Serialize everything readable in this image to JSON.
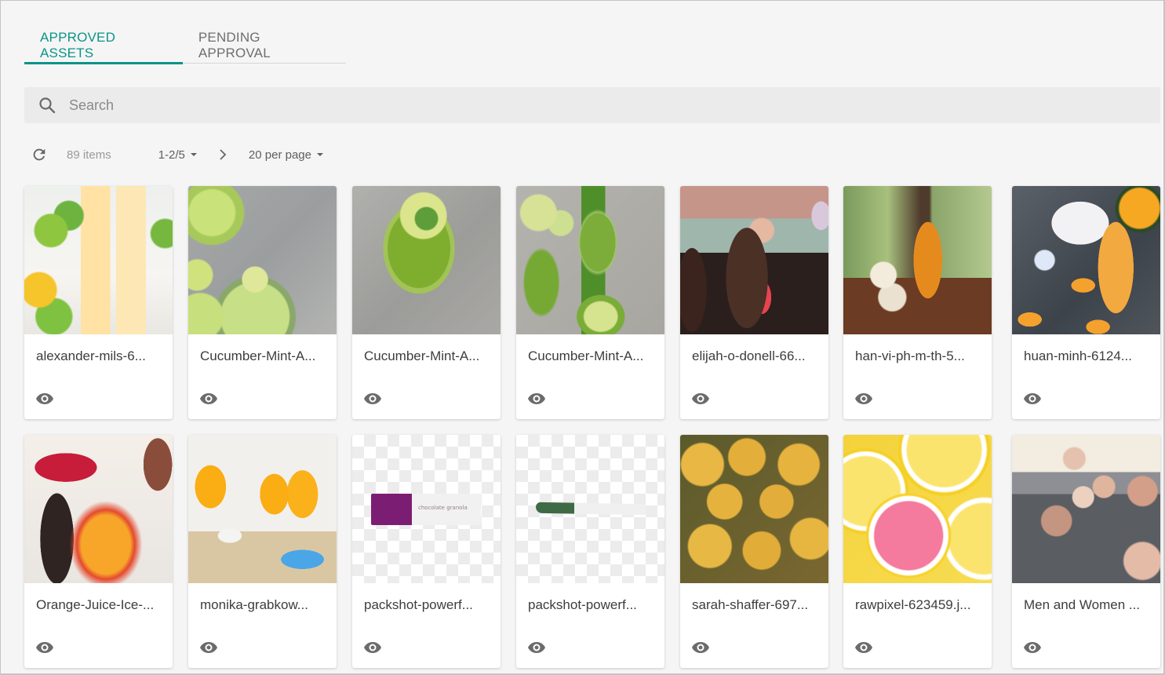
{
  "tabs": [
    {
      "label": "APPROVED ASSETS",
      "active": true
    },
    {
      "label": "PENDING APPROVAL",
      "active": false
    }
  ],
  "accent_color": "#0b9488",
  "search": {
    "placeholder": "Search",
    "value": "",
    "icon": "search-icon"
  },
  "toolbar": {
    "refresh_icon": "refresh-icon",
    "item_count": "89 items",
    "page_range": "1-2/5",
    "next_icon": "chevron-right-icon",
    "per_page": "20 per page"
  },
  "assets": [
    {
      "name": "alexander-mils-6...",
      "thumb": "t-alex",
      "action_icon": "eye-icon"
    },
    {
      "name": "Cucumber-Mint-A...",
      "thumb": "t-cuc1",
      "action_icon": "eye-icon"
    },
    {
      "name": "Cucumber-Mint-A...",
      "thumb": "t-cuc2",
      "action_icon": "eye-icon"
    },
    {
      "name": "Cucumber-Mint-A...",
      "thumb": "t-cuc3",
      "action_icon": "eye-icon"
    },
    {
      "name": "elijah-o-donell-66...",
      "thumb": "t-elijah",
      "action_icon": "eye-icon"
    },
    {
      "name": "han-vi-ph-m-th-5...",
      "thumb": "t-han",
      "action_icon": "eye-icon"
    },
    {
      "name": "huan-minh-6124...",
      "thumb": "t-huan",
      "action_icon": "eye-icon"
    },
    {
      "name": "Orange-Juice-Ice-...",
      "thumb": "t-orange",
      "action_icon": "eye-icon"
    },
    {
      "name": "monika-grabkow...",
      "thumb": "t-monika",
      "action_icon": "eye-icon"
    },
    {
      "name": "packshot-powerf...",
      "thumb": "t-check",
      "action_icon": "eye-icon",
      "product_label": "chocolate granola"
    },
    {
      "name": "packshot-powerf...",
      "thumb": "t-check",
      "action_icon": "eye-icon"
    },
    {
      "name": "sarah-shaffer-697...",
      "thumb": "t-sarah",
      "action_icon": "eye-icon"
    },
    {
      "name": "rawpixel-623459.j...",
      "thumb": "t-raw",
      "action_icon": "eye-icon"
    },
    {
      "name": "Men and Women ...",
      "thumb": "t-men",
      "action_icon": "eye-icon"
    }
  ]
}
